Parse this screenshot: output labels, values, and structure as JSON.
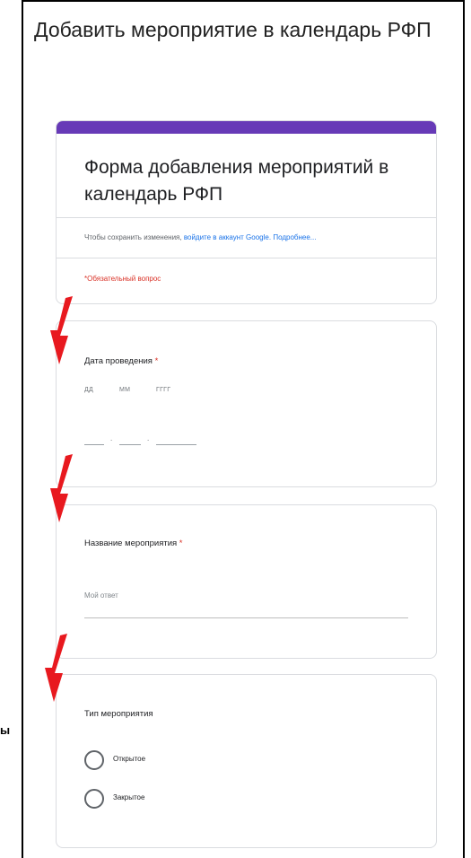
{
  "page": {
    "title": "Добавить мероприятие в календарь РФП"
  },
  "form": {
    "header_color": "#673ab7",
    "title": "Форма добавления мероприятий в календарь РФП",
    "save_note_prefix": "Чтобы сохранить изменения, ",
    "sign_in_link": "войдите в аккаунт Google.",
    "learn_more_link": "Подробнее...",
    "required_note": "*Обязательный вопрос"
  },
  "questions": {
    "date": {
      "title": "Дата проведения",
      "required_mark": "*",
      "day_label": "ДД",
      "month_label": "ММ",
      "year_label": "ГГГГ",
      "separator": "."
    },
    "name": {
      "title": "Название мероприятия",
      "required_mark": "*",
      "placeholder": "Мой ответ"
    },
    "type": {
      "title": "Тип мероприятия",
      "options": [
        "Открытое",
        "Закрытое"
      ]
    }
  },
  "annotations": {
    "arrow_color": "#e8191f",
    "side_fragment": "ы"
  }
}
